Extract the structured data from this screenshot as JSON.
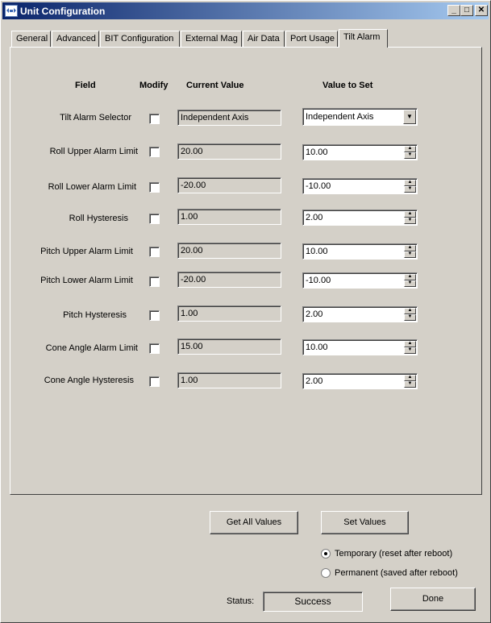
{
  "window": {
    "title": "Unit Configuration",
    "min_glyph": "_",
    "max_glyph": "□",
    "close_glyph": "✕"
  },
  "tabs": [
    {
      "label": "General"
    },
    {
      "label": "Advanced"
    },
    {
      "label": "BIT Configuration"
    },
    {
      "label": "External Mag"
    },
    {
      "label": "Air Data"
    },
    {
      "label": "Port Usage"
    },
    {
      "label": "Tilt Alarm",
      "active": true
    }
  ],
  "headers": {
    "field": "Field",
    "modify": "Modify",
    "current": "Current Value",
    "set": "Value to Set"
  },
  "rows": [
    {
      "label": "Tilt Alarm Selector",
      "modify": false,
      "current": "Independent Axis",
      "set": "Independent Axis",
      "control": "dropdown"
    },
    {
      "label": "Roll Upper Alarm Limit",
      "modify": false,
      "current": "20.00",
      "set": "10.00"
    },
    {
      "label": "Roll Lower Alarm Limit",
      "modify": false,
      "current": "-20.00",
      "set": "-10.00"
    },
    {
      "label": "Roll Hysteresis",
      "modify": false,
      "current": "1.00",
      "set": "2.00"
    },
    {
      "label": "Pitch Upper Alarm Limit",
      "modify": false,
      "current": "20.00",
      "set": "10.00"
    },
    {
      "label": "Pitch Lower Alarm Limit",
      "modify": false,
      "current": "-20.00",
      "set": "-10.00"
    },
    {
      "label": "Pitch Hysteresis",
      "modify": false,
      "current": "1.00",
      "set": "2.00"
    },
    {
      "label": "Cone Angle Alarm Limit",
      "modify": false,
      "current": "15.00",
      "set": "10.00"
    },
    {
      "label": "Cone Angle Hysteresis",
      "modify": false,
      "current": "1.00",
      "set": "2.00"
    }
  ],
  "buttons": {
    "get_all": "Get All Values",
    "set_values": "Set Values",
    "done": "Done"
  },
  "mode": {
    "temporary": "Temporary (reset after reboot)",
    "permanent": "Permanent (saved after reboot)",
    "selected": "temporary"
  },
  "status": {
    "label": "Status:",
    "value": "Success"
  }
}
